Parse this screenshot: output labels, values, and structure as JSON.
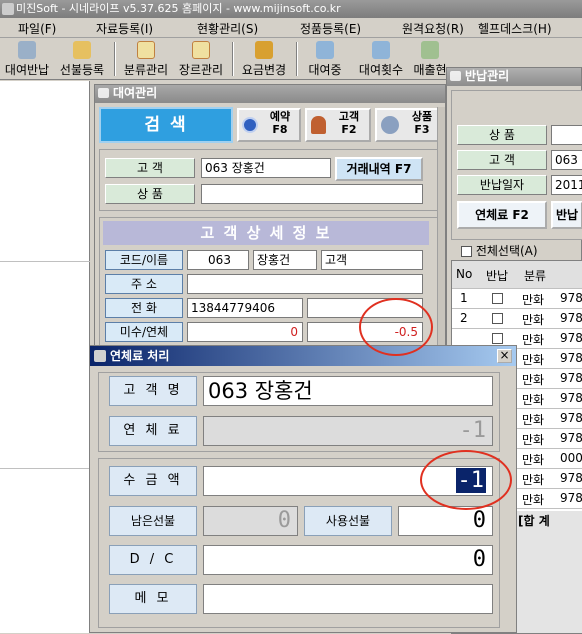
{
  "app": {
    "title": "미진Soft - 시네라이프 v5.37.625 홈페이지 - www.mijinsoft.co.kr",
    "menu": [
      "파일(F)",
      "자료등록(I)",
      "현황관리(S)",
      "정품등록(E)",
      "원격요청(R)",
      "헬프데스크(H)"
    ],
    "toolbar": [
      "대여반납",
      "선불등록",
      "분류관리",
      "장르관리",
      "요금변경",
      "대여중",
      "대여횟수",
      "매출현"
    ]
  },
  "rental": {
    "title": "대여관리",
    "search_label": "검 색",
    "reserve_label": "예약",
    "reserve_key": "F8",
    "customer_label": "고객",
    "customer_key": "F2",
    "product_label": "상품",
    "product_key": "F3",
    "customer_field_label": "고 객",
    "customer_value": "063 장홍건",
    "history_button": "거래내역 F7",
    "product_field_label": "상 품",
    "detail_header": "고 객 상 세 정 보",
    "code_label": "코드/이름",
    "code_value": "063",
    "name_value": "장홍건",
    "type_value": "고객",
    "address_label": "주 소",
    "phone_label": "전 화",
    "phone_value": "13844779406",
    "unpaid_label": "미수/연체",
    "unpaid_value": "0",
    "overdue_value": "-0.5"
  },
  "late_fee": {
    "title": "연체료 처리",
    "name_label": "고 객 명",
    "name_value": "063 장홍건",
    "fee_label": "연 체 료",
    "fee_value": "-1",
    "receive_label": "수 금 액",
    "receive_value": "-1",
    "prepaid_left_label": "남은선불",
    "prepaid_left_value": "0",
    "prepaid_use_label": "사용선불",
    "prepaid_use_value": "0",
    "dc_label": "D / C",
    "dc_value": "0",
    "memo_label": "메 모"
  },
  "return": {
    "title": "반납관리",
    "product_label": "상 품",
    "customer_label": "고 객",
    "customer_value": "063",
    "date_label": "반납일자",
    "date_value": "2011",
    "late_button": "연체료 F2",
    "return_button": "반납",
    "select_all": "전체선택(A)",
    "headers": [
      "No",
      "반납",
      "분류",
      ""
    ],
    "rows": [
      {
        "no": "1",
        "cat": "만화",
        "code": "978"
      },
      {
        "no": "2",
        "cat": "만화",
        "code": "978"
      },
      {
        "no": "",
        "cat": "만화",
        "code": "978"
      },
      {
        "no": "",
        "cat": "만화",
        "code": "978"
      },
      {
        "no": "",
        "cat": "만화",
        "code": "978"
      },
      {
        "no": "",
        "cat": "만화",
        "code": "978"
      },
      {
        "no": "",
        "cat": "만화",
        "code": "978"
      },
      {
        "no": "",
        "cat": "만화",
        "code": "978"
      },
      {
        "no": "",
        "cat": "만화",
        "code": "000"
      },
      {
        "no": "",
        "cat": "만화",
        "code": "978"
      },
      {
        "no": "",
        "cat": "만화",
        "code": "978"
      }
    ],
    "total_label": "[합 계"
  }
}
